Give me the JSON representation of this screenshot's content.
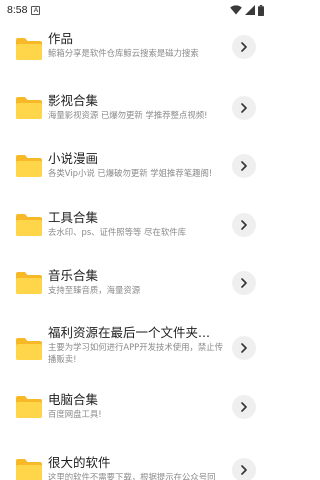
{
  "status": {
    "time": "8:58",
    "notif_letter": "A"
  },
  "items": [
    {
      "title": "作品",
      "desc": "鲸箱分享是软件仓库鲸云搜索是磁力搜索"
    },
    {
      "title": "影视合集",
      "desc": "海量影视资源 已爆勿更新 学推荐整点视频!"
    },
    {
      "title": "小说漫画",
      "desc": "各类Vip小说 已爆破勿更新 学姐推荐笔趣阁!"
    },
    {
      "title": "工具合集",
      "desc": "去水印、ps、证件照等等 尽在软件库"
    },
    {
      "title": "音乐合集",
      "desc": "支持至臻音质，海量资源"
    },
    {
      "title": "福利资源在最后一个文件夹...",
      "desc": "主要为学习如何进行APP开发技术使用，禁止传播贩卖!"
    },
    {
      "title": "电脑合集",
      "desc": "百度网盘工具!"
    },
    {
      "title": "很大的软件",
      "desc": "这里的软件不需要下载，根据提示在公众号回"
    }
  ],
  "colors": {
    "folder_back": "#F7B928",
    "folder_front": "#FFD54A",
    "chevron_bg": "#EFEFEF"
  },
  "icons": {
    "folder": "folder-icon",
    "chevron": "chevron-right-icon"
  }
}
